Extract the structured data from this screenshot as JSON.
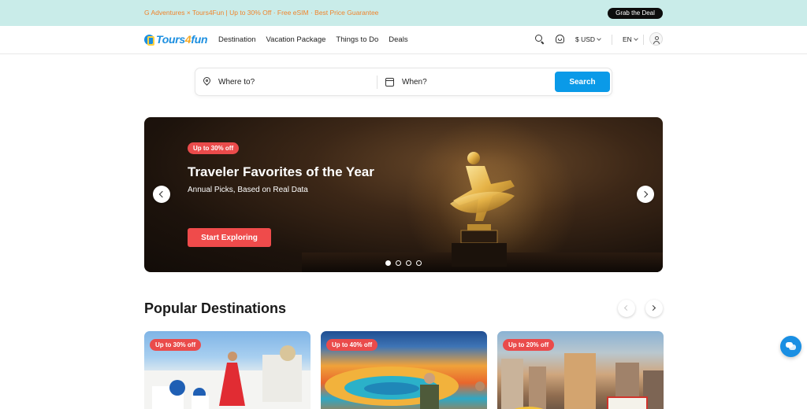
{
  "promo": {
    "text": "G Adventures × Tours4Fun | Up to 30% Off · Free eSIM · Best Price Guarantee",
    "button_label": "Grab the Deal"
  },
  "header": {
    "logo": {
      "prefix": "Tours",
      "four": "4",
      "suffix": "fun"
    },
    "nav": [
      "Destination",
      "Vacation Package",
      "Things to Do",
      "Deals"
    ],
    "currency": "$ USD",
    "language": "EN",
    "icons": {
      "search": "search-icon",
      "support": "customer-support-icon",
      "user": "user-icon"
    }
  },
  "search": {
    "where_placeholder": "Where to?",
    "when_placeholder": "When?",
    "button_label": "Search"
  },
  "hero": {
    "badge": "Up to 30% off",
    "title": "Traveler Favorites of the Year",
    "subtitle": "Annual Picks, Based on Real Data",
    "cta": "Start Exploring",
    "slides_count": 4,
    "active_slide": 1
  },
  "popular": {
    "title": "Popular Destinations",
    "cards": [
      {
        "badge": "Up to 30% off",
        "image": "santorini-photo"
      },
      {
        "badge": "Up to 40% off",
        "image": "hot-spring-photo"
      },
      {
        "badge": "Up to 20% off",
        "image": "las-vegas-photo"
      }
    ]
  },
  "colors": {
    "accent_blue": "#0a9ae8",
    "promo_bg": "#c9ece9",
    "promo_text": "#f0842c",
    "badge_red": "#ea4b4b"
  }
}
